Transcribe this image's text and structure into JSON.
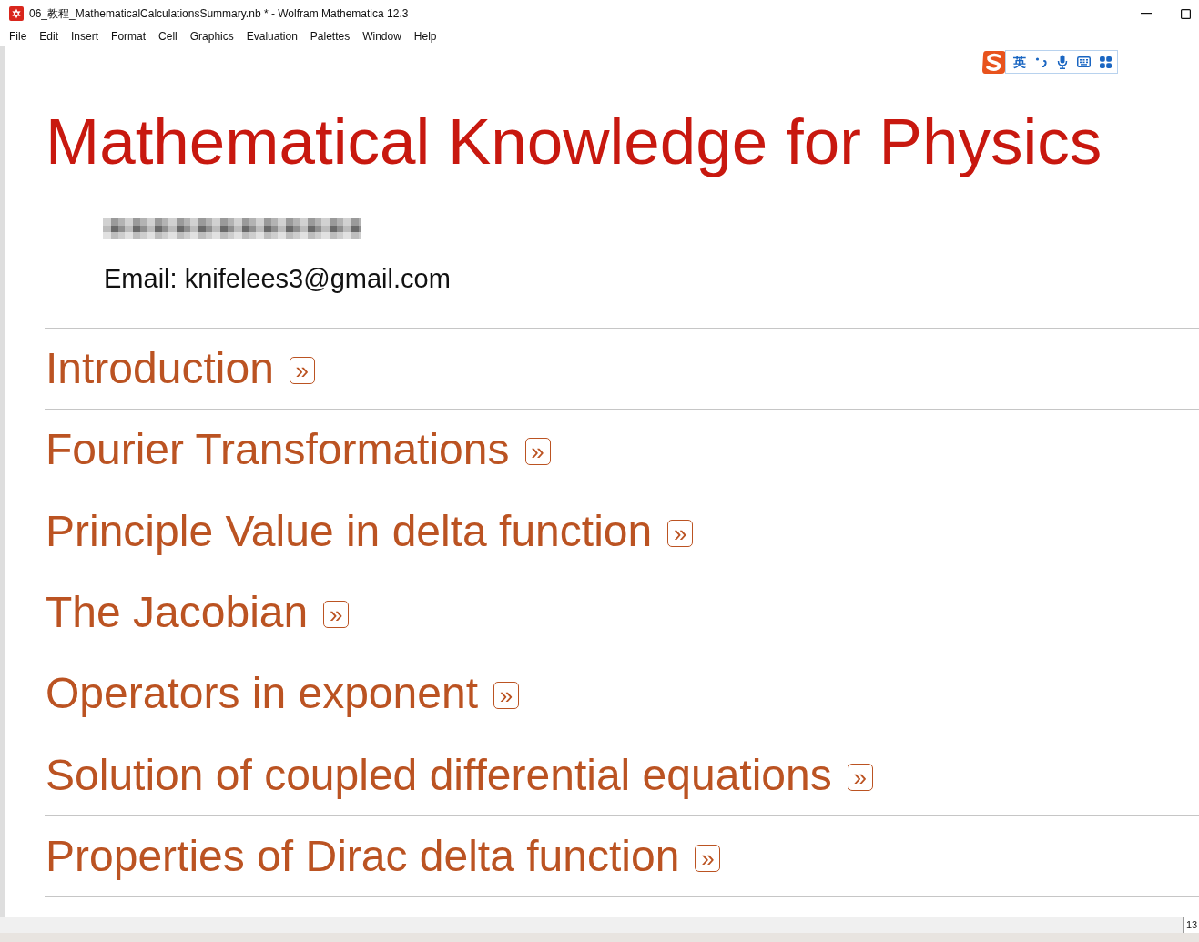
{
  "window": {
    "title": "06_教程_MathematicalCalculationsSummary.nb * - Wolfram Mathematica 12.3"
  },
  "menu": [
    "File",
    "Edit",
    "Insert",
    "Format",
    "Cell",
    "Graphics",
    "Evaluation",
    "Palettes",
    "Window",
    "Help"
  ],
  "ime_toolbar": {
    "language": "英"
  },
  "notebook": {
    "title": "Mathematical Knowledge for Physics",
    "email": "Email: knifelees3@gmail.com",
    "sections": [
      {
        "title": "Introduction",
        "link": "»"
      },
      {
        "title": "Fourier Transformations",
        "link": "»"
      },
      {
        "title": "Principle Value in delta function",
        "link": "»"
      },
      {
        "title": "The Jacobian",
        "link": "»"
      },
      {
        "title": "Operators in exponent",
        "link": "»"
      },
      {
        "title": "Solution of coupled differential equations",
        "link": "»"
      },
      {
        "title": "Properties of Dirac delta function",
        "link": "»"
      }
    ]
  },
  "status_bar": {
    "zoom": "13"
  }
}
